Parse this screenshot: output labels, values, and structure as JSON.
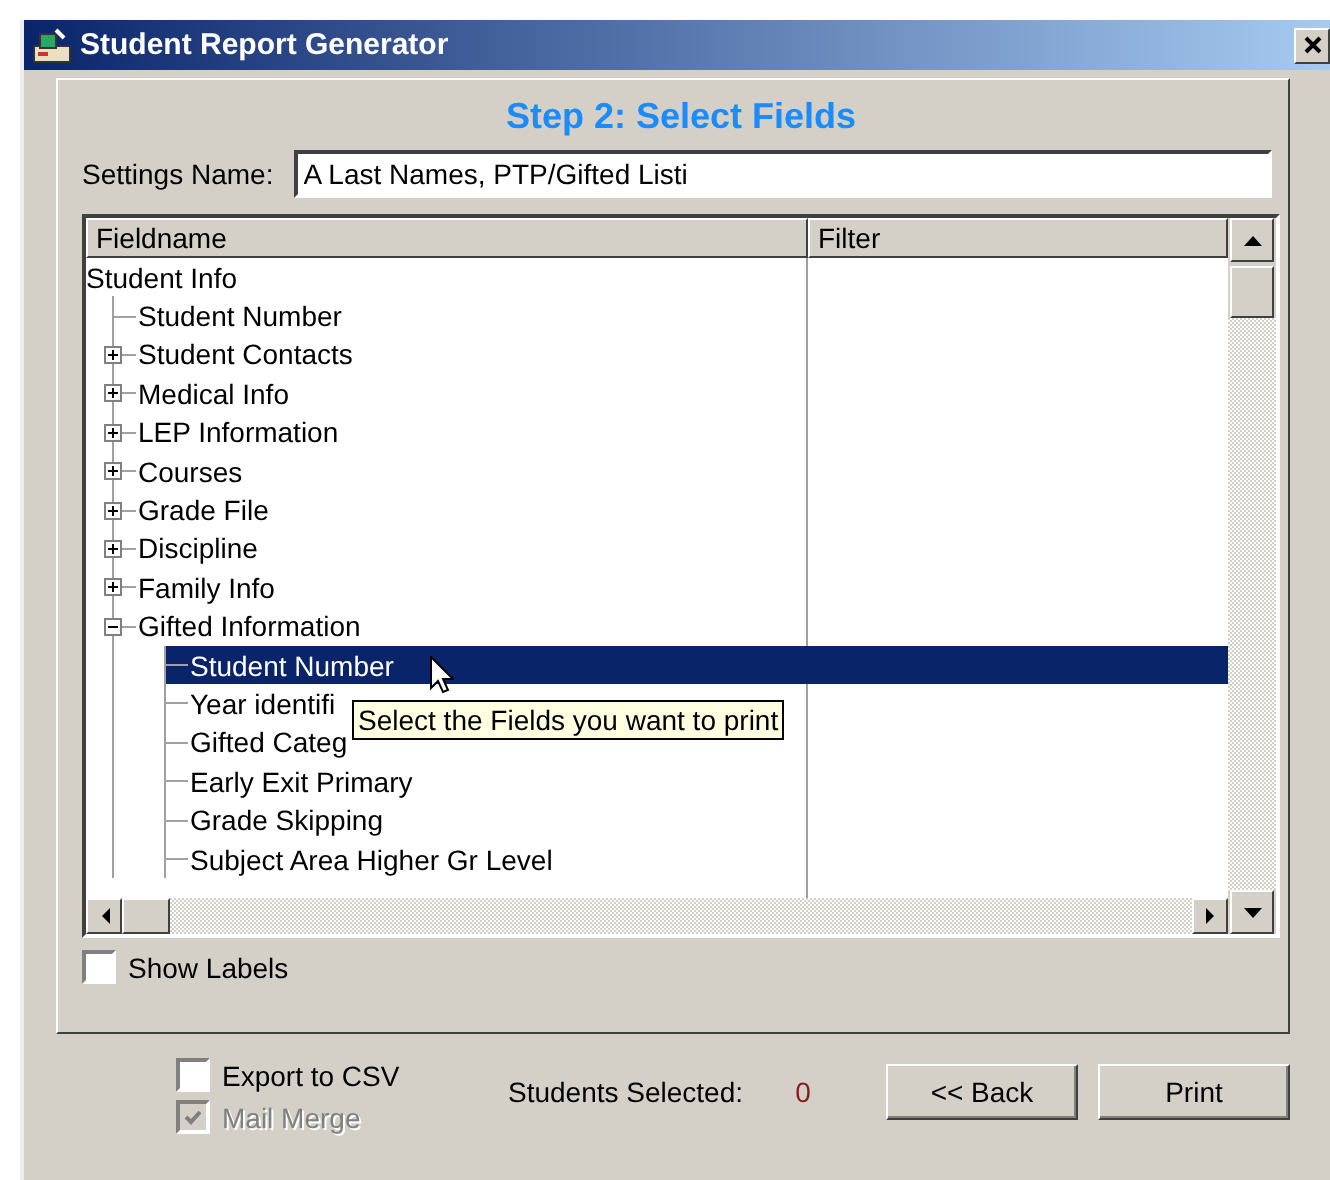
{
  "window": {
    "title": "Student Report Generator"
  },
  "heading": "Step 2: Select Fields",
  "settings": {
    "label": "Settings Name:",
    "value": "A Last Names, PTP/Gifted Listi"
  },
  "list": {
    "columns": [
      "Fieldname",
      "Filter"
    ],
    "tree": [
      {
        "label": "Student Info",
        "selected": false,
        "children": [
          {
            "label": "Student Number",
            "selected": false
          },
          {
            "label": "Student Contacts",
            "expanded": false,
            "selected": false
          },
          {
            "label": "Medical Info",
            "expanded": false,
            "selected": false
          },
          {
            "label": "LEP Information",
            "expanded": false,
            "selected": false
          },
          {
            "label": "Courses",
            "expanded": false,
            "selected": false
          },
          {
            "label": "Grade File",
            "expanded": false,
            "selected": false
          },
          {
            "label": "Discipline",
            "expanded": false,
            "selected": false
          },
          {
            "label": "Family Info",
            "expanded": false,
            "selected": false
          },
          {
            "label": "Gifted Information",
            "expanded": true,
            "selected": false,
            "children": [
              {
                "label": "Student Number",
                "selected": true
              },
              {
                "label": "Year identifi",
                "selected": false
              },
              {
                "label": "Gifted Categ",
                "selected": false
              },
              {
                "label": "Early Exit Primary",
                "selected": false
              },
              {
                "label": "Grade Skipping",
                "selected": false
              },
              {
                "label": "Subject Area Higher Gr Level",
                "selected": false
              }
            ]
          }
        ]
      }
    ],
    "tooltip": "Select the Fields you want to print"
  },
  "show_labels": {
    "label": "Show Labels",
    "checked": false,
    "disabled": false
  },
  "export_csv": {
    "label": "Export to CSV",
    "checked": false,
    "disabled": false
  },
  "mail_merge": {
    "label": "Mail Merge",
    "checked": true,
    "disabled": true
  },
  "students_selected": {
    "label": "Students Selected:",
    "count": "0"
  },
  "buttons": [
    "<< Back",
    "Print"
  ]
}
